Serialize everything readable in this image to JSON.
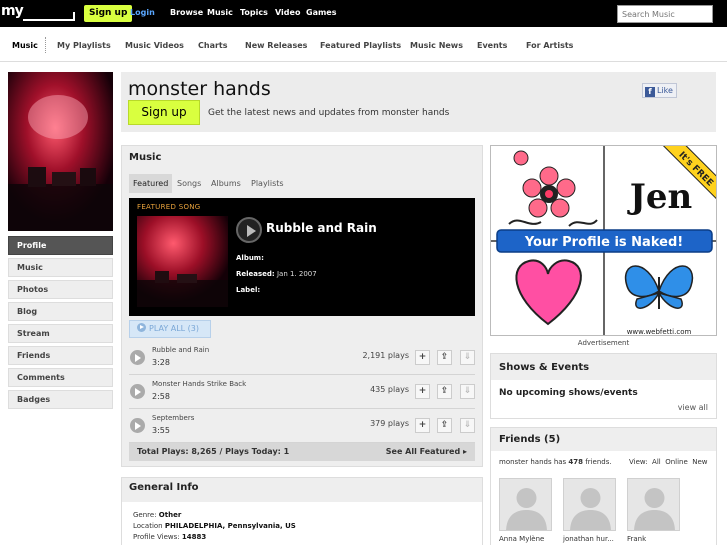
{
  "topbar": {
    "logo": "my",
    "signup": "Sign up",
    "login": "Login",
    "nav": [
      "Browse",
      "Music",
      "Topics",
      "Video",
      "Games"
    ],
    "search_placeholder": "Search Music"
  },
  "subnav": [
    "Music",
    "My Playlists",
    "Music Videos",
    "Charts",
    "New Releases",
    "Featured Playlists",
    "Music News",
    "Events",
    "For Artists"
  ],
  "leftnav": [
    "Profile",
    "Music",
    "Photos",
    "Blog",
    "Stream",
    "Friends",
    "Comments",
    "Badges"
  ],
  "header": {
    "artist": "monster hands",
    "signup": "Sign up",
    "blurb": "Get the latest news and updates from monster hands",
    "like": "Like"
  },
  "music": {
    "title": "Music",
    "tabs": [
      "Featured",
      "Songs",
      "Albums",
      "Playlists"
    ],
    "featured": {
      "label": "FEATURED SONG",
      "title": "Rubble and Rain",
      "album_label": "Album:",
      "released_label": "Released:",
      "released_value": "Jan 1. 2007",
      "label_label": "Label:"
    },
    "play_all": "PLAY ALL (3)",
    "songs": [
      {
        "title": "Rubble and Rain",
        "duration": "3:28",
        "plays": "2,191 plays"
      },
      {
        "title": "Monster Hands Strike Back",
        "duration": "2:58",
        "plays": "435 plays"
      },
      {
        "title": "Septembers",
        "duration": "3:55",
        "plays": "379 plays"
      }
    ],
    "totals": "Total Plays: 8,265 / Plays Today: 1",
    "see_all": "See All Featured ▸"
  },
  "general": {
    "title": "General Info",
    "genre_label": "Genre:",
    "genre": "Other",
    "location_label": "Location",
    "location": "PHILADELPHIA, Pennsylvania, US",
    "views_label": "Profile Views:",
    "views": "14883"
  },
  "ad": {
    "caption": "Advertisement",
    "name": "Jen",
    "banner": "Your Profile is Naked!",
    "ribbon": "It's FREE",
    "url": "www.webfetti.com"
  },
  "shows": {
    "title": "Shows & Events",
    "empty": "No upcoming shows/events",
    "view_all": "view all"
  },
  "friends": {
    "title": "Friends (5)",
    "count_prefix": "monster hands has ",
    "count": "478",
    "count_suffix": " friends.",
    "view_label": "View:",
    "view_all": "All",
    "view_online": "Online",
    "view_new": "New",
    "people": [
      "Anna Mylène",
      "jonathan hur...",
      "Frank"
    ]
  },
  "colors": {
    "accent": "#d9ff3f",
    "link": "#5aa7ff",
    "featured_label": "#e8a23c"
  }
}
